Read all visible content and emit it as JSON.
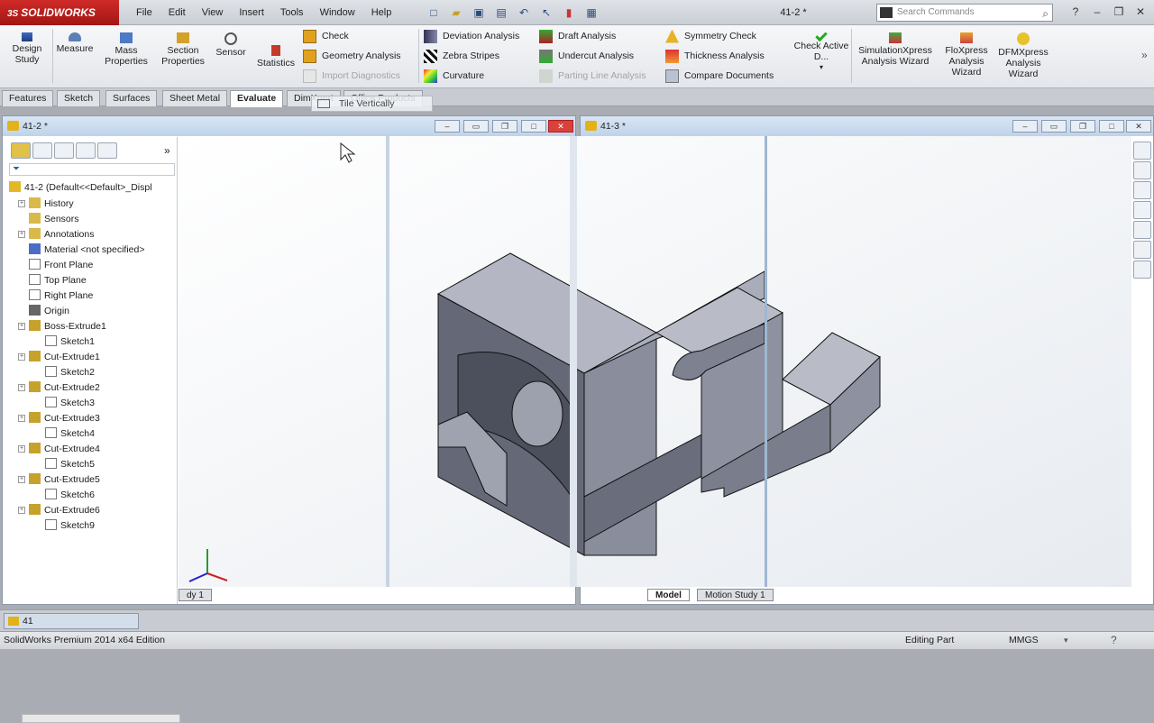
{
  "app": {
    "logo": "SOLIDWORKS",
    "menus": [
      "File",
      "Edit",
      "View",
      "Insert",
      "Tools",
      "Window",
      "Help"
    ],
    "doc_title": "41-2 *",
    "search_placeholder": "Search Commands"
  },
  "commands": {
    "design_study": "Design Study",
    "measure": "Measure",
    "mass_properties": "Mass Properties",
    "section_properties": "Section Properties",
    "sensor": "Sensor",
    "statistics": "Statistics",
    "check": "Check",
    "geometry_analysis": "Geometry Analysis",
    "import_diagnostics": "Import Diagnostics",
    "deviation_analysis": "Deviation Analysis",
    "zebra_stripes": "Zebra Stripes",
    "curvature": "Curvature",
    "draft_analysis": "Draft Analysis",
    "undercut_analysis": "Undercut Analysis",
    "parting_line_analysis": "Parting Line Analysis",
    "symmetry_check": "Symmetry Check",
    "thickness_analysis": "Thickness Analysis",
    "compare_documents": "Compare Documents",
    "check_active_doc": "Check Active D...",
    "simulationxpress": "SimulationXpress Analysis Wizard",
    "floxpress": "FloXpress Analysis Wizard",
    "dfmxpress": "DFMXpress Analysis Wizard"
  },
  "tabs": [
    "Features",
    "Sketch",
    "Surfaces",
    "Sheet Metal",
    "Evaluate",
    "DimXpert",
    "Office Products"
  ],
  "tooltip": "Tile Vertically",
  "windows": {
    "left_title": "41-2 *",
    "right_title": "41-3 *"
  },
  "tree": {
    "root": "41-2  (Default<<Default>_Displ",
    "items": [
      {
        "label": "History",
        "icon": "history-icon",
        "level": 1,
        "expand": true
      },
      {
        "label": "Sensors",
        "icon": "sensors-icon",
        "level": 1,
        "expand": false
      },
      {
        "label": "Annotations",
        "icon": "annotations-icon",
        "level": 1,
        "expand": true
      },
      {
        "label": "Material <not specified>",
        "icon": "material-icon",
        "level": 1,
        "expand": false
      },
      {
        "label": "Front Plane",
        "icon": "plane-icon",
        "level": 1,
        "expand": false
      },
      {
        "label": "Top Plane",
        "icon": "plane-icon",
        "level": 1,
        "expand": false
      },
      {
        "label": "Right Plane",
        "icon": "plane-icon",
        "level": 1,
        "expand": false
      },
      {
        "label": "Origin",
        "icon": "origin-icon",
        "level": 1,
        "expand": false
      },
      {
        "label": "Boss-Extrude1",
        "icon": "feature-icon",
        "level": 1,
        "expand": true
      },
      {
        "label": "Sketch1",
        "icon": "sketch-icon",
        "level": 2,
        "expand": false
      },
      {
        "label": "Cut-Extrude1",
        "icon": "feature-icon",
        "level": 1,
        "expand": true
      },
      {
        "label": "Sketch2",
        "icon": "sketch-icon",
        "level": 2,
        "expand": false
      },
      {
        "label": "Cut-Extrude2",
        "icon": "feature-icon",
        "level": 1,
        "expand": true
      },
      {
        "label": "Sketch3",
        "icon": "sketch-icon",
        "level": 2,
        "expand": false
      },
      {
        "label": "Cut-Extrude3",
        "icon": "feature-icon",
        "level": 1,
        "expand": true
      },
      {
        "label": "Sketch4",
        "icon": "sketch-icon",
        "level": 2,
        "expand": false
      },
      {
        "label": "Cut-Extrude4",
        "icon": "feature-icon",
        "level": 1,
        "expand": true
      },
      {
        "label": "Sketch5",
        "icon": "sketch-icon",
        "level": 2,
        "expand": false
      },
      {
        "label": "Cut-Extrude5",
        "icon": "feature-icon",
        "level": 1,
        "expand": true
      },
      {
        "label": "Sketch6",
        "icon": "sketch-icon",
        "level": 2,
        "expand": false
      },
      {
        "label": "Cut-Extrude6",
        "icon": "feature-icon",
        "level": 1,
        "expand": true
      },
      {
        "label": "Sketch9",
        "icon": "sketch-icon",
        "level": 2,
        "expand": false
      }
    ]
  },
  "bottom": {
    "model_tab": "Model",
    "motion_tab": "Motion Study 1",
    "left_tab": "dy 1",
    "taskbar_item": "41"
  },
  "status": {
    "edition": "SolidWorks Premium 2014 x64 Edition",
    "mode": "Editing Part",
    "units": "MMGS"
  }
}
